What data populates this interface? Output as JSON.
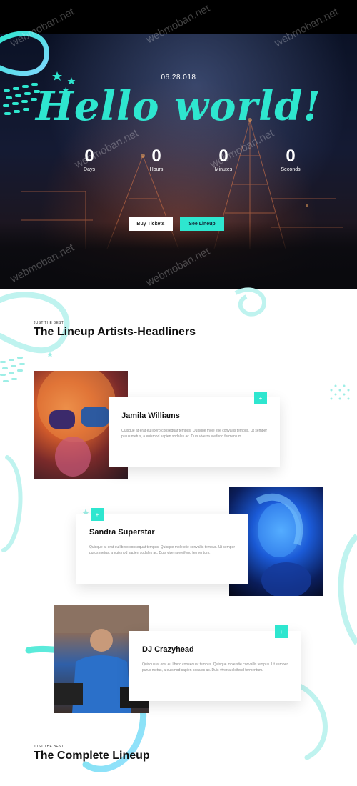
{
  "hero": {
    "date": "06.28.018",
    "title": "Hello world!",
    "countdown": [
      {
        "value": "0",
        "label": "Days"
      },
      {
        "value": "0",
        "label": "Hours"
      },
      {
        "value": "0",
        "label": "Minutes"
      },
      {
        "value": "0",
        "label": "Seconds"
      }
    ],
    "buttons": {
      "buy": "Buy Tickets",
      "see": "See Lineup"
    }
  },
  "watermark": "webmoban.net",
  "lineup": {
    "eyebrow": "JUST THE BEST",
    "title": "The Lineup Artists-Headliners",
    "artists": [
      {
        "name": "Jamila Williams",
        "text": "Quisque at erat eu libero consequat tempus. Quisque mole stie convallis tempus. Ut semper purus metus, a euismod sapien sodales ac. Duis viverra eleifend fermentum.",
        "plus": "+"
      },
      {
        "name": "Sandra Superstar",
        "text": "Quisque at erat eu libero consequat tempus. Quisque mole stie convallis tempus. Ut semper purus metus, a euismod sapien sodales ac. Duis viverra eleifend fermentum.",
        "plus": "+"
      },
      {
        "name": "DJ Crazyhead",
        "text": "Quisque at erat eu libero consequat tempus. Quisque mole stie convallis tempus. Ut semper purus metus, a euismod sapien sodales ac. Duis viverra eleifend fermentum.",
        "plus": "+"
      }
    ]
  },
  "complete": {
    "eyebrow": "JUST THE BEST",
    "title": "The Complete Lineup"
  },
  "colors": {
    "accent": "#2ee6cf",
    "dark": "#0b1226"
  }
}
